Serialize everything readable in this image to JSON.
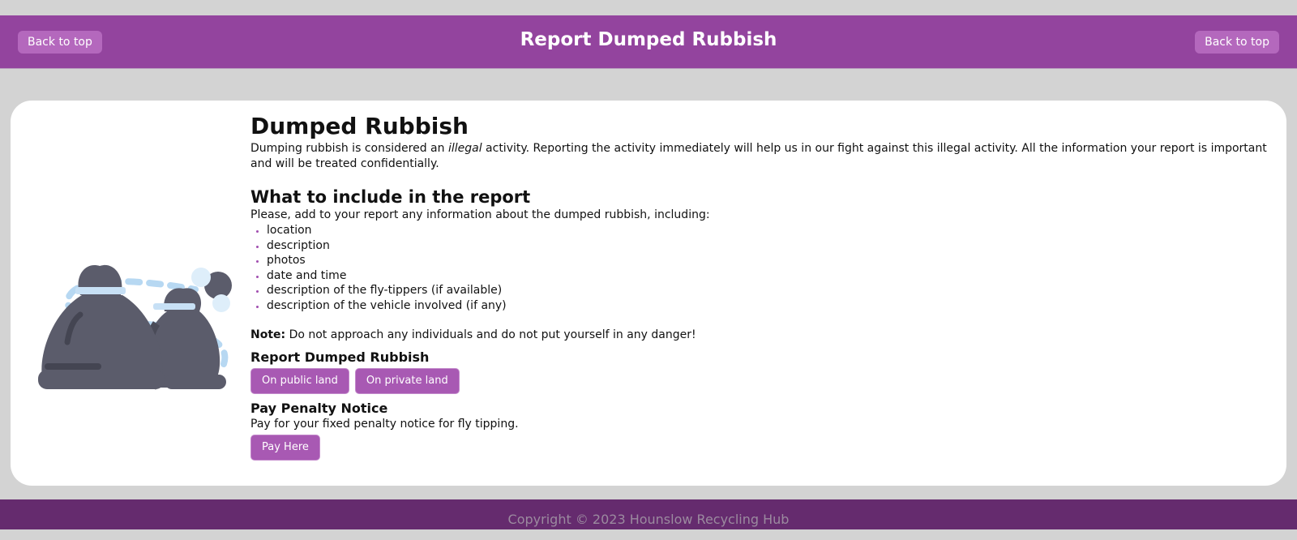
{
  "header": {
    "title": "Report Dumped Rubbish",
    "back_to_top_left": "Back to top",
    "back_to_top_right": "Back to top"
  },
  "main": {
    "heading": "Dumped Rubbish",
    "intro_before": "Dumping rubbish is considered an ",
    "intro_emphasis": "illegal",
    "intro_after": " activity. Reporting the activity immediately will help us in our fight against this illegal activity. All the information your report is important and will be treated confidentially.",
    "include_heading": "What to include in the report",
    "include_intro": "Please, add to your report any information about the dumped rubbish, including:",
    "include_items": [
      "location",
      "description",
      "photos",
      "date and time",
      "description of the fly-tippers (if available)",
      "description of the vehicle involved (if any)"
    ],
    "note_label": "Note:",
    "note_text": " Do not approach any individuals and do not put yourself in any danger!",
    "report_heading": "Report Dumped Rubbish",
    "public_land_button": "On public land",
    "private_land_button": "On private land",
    "penalty_heading": "Pay Penalty Notice",
    "penalty_text": "Pay for your fixed penalty notice for fly tipping.",
    "pay_button": "Pay Here"
  },
  "illustration": {
    "icon": "rubbish-bags-icon"
  },
  "footer": {
    "copyright": "Copyright © 2023 Hounslow Recycling Hub"
  },
  "colors": {
    "header_bg": "#93449e",
    "button_bg": "#a859b3",
    "footer_bg": "#652b6e",
    "page_bg": "#d3d3d3"
  }
}
